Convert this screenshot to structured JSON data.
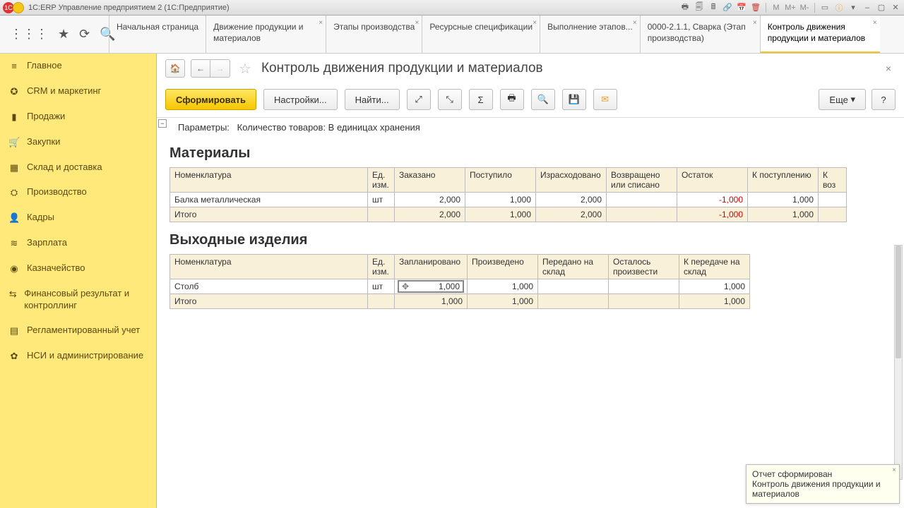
{
  "title": "1С:ERP Управление предприятием 2  (1С:Предприятие)",
  "titlebar_icons": [
    "M",
    "M+",
    "M-"
  ],
  "tabs": [
    {
      "label": "Начальная страница"
    },
    {
      "label": "Движение продукции и материалов"
    },
    {
      "label": "Этапы производства"
    },
    {
      "label": "Ресурсные спецификации"
    },
    {
      "label": "Выполнение этапов..."
    },
    {
      "label": "0000-2.1.1, Сварка (Этап производства)"
    },
    {
      "label": "Контроль движения продукции и материалов",
      "active": true
    }
  ],
  "sidebar": [
    {
      "icon": "≡",
      "label": "Главное"
    },
    {
      "icon": "✪",
      "label": "CRM и маркетинг"
    },
    {
      "icon": "▮",
      "label": "Продажи"
    },
    {
      "icon": "🛒",
      "label": "Закупки"
    },
    {
      "icon": "▦",
      "label": "Склад и доставка"
    },
    {
      "icon": "⛭",
      "label": "Производство"
    },
    {
      "icon": "👤",
      "label": "Кадры"
    },
    {
      "icon": "≋",
      "label": "Зарплата"
    },
    {
      "icon": "◉",
      "label": "Казначейство"
    },
    {
      "icon": "⇆",
      "label": "Финансовый результат и контроллинг"
    },
    {
      "icon": "▤",
      "label": "Регламентированный учет"
    },
    {
      "icon": "✿",
      "label": "НСИ и администрирование"
    }
  ],
  "page": {
    "title": "Контроль движения продукции и материалов",
    "buttons": {
      "generate": "Сформировать",
      "settings": "Настройки...",
      "find": "Найти...",
      "more": "Еще",
      "help": "?"
    },
    "params_label": "Параметры:",
    "params_value": "Количество товаров: В единицах хранения",
    "sec1": {
      "title": "Материалы",
      "head": [
        "Номенклатура",
        "Ед. изм.",
        "Заказано",
        "Поступило",
        "Израсходовано",
        "Возвращено или списано",
        "Остаток",
        "К поступлению",
        "К воз"
      ],
      "row": {
        "name": "Балка металлическая",
        "unit": "шт",
        "ordered": "2,000",
        "received": "1,000",
        "spent": "2,000",
        "ret": "",
        "balance": "-1,000",
        "toreceive": "1,000"
      },
      "total_label": "Итого",
      "total": {
        "ordered": "2,000",
        "received": "1,000",
        "spent": "2,000",
        "ret": "",
        "balance": "-1,000",
        "toreceive": "1,000"
      }
    },
    "sec2": {
      "title": "Выходные изделия",
      "head": [
        "Номенклатура",
        "Ед. изм.",
        "Запланировано",
        "Произведено",
        "Передано на склад",
        "Осталось произвести",
        "К передаче на склад"
      ],
      "row": {
        "name": "Столб",
        "unit": "шт",
        "planned": "1,000",
        "produced": "1,000",
        "sent": "",
        "remain": "",
        "tosend": "1,000"
      },
      "total_label": "Итого",
      "total": {
        "planned": "1,000",
        "produced": "1,000",
        "sent": "",
        "remain": "",
        "tosend": "1,000"
      }
    }
  },
  "toast": {
    "line1": "Отчет сформирован",
    "line2": "Контроль движения продукции и материалов"
  }
}
